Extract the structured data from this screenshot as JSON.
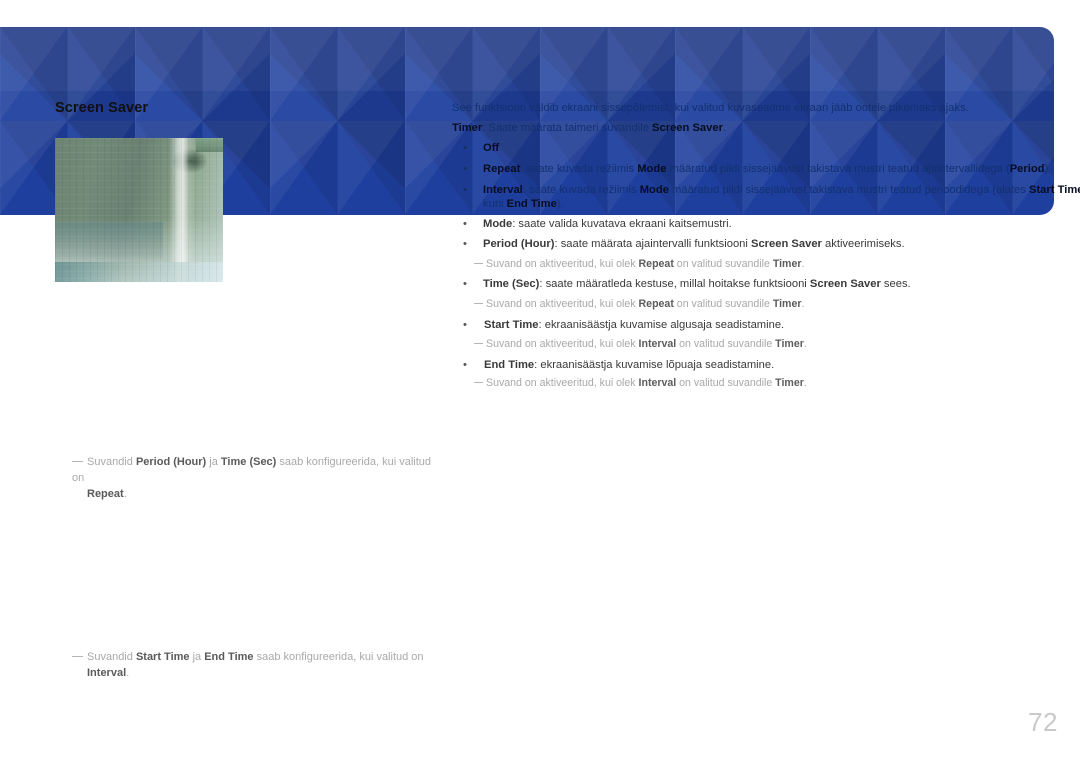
{
  "page": {
    "title": "Screen Saver",
    "number": "72",
    "band_color": "#1f3f9e",
    "thumbnail_name": "screen-saver-preview"
  },
  "intro": {
    "line1": "See funktsioon väldib ekraani sissepõlemist, kui valitud kuvaseadme ekraan jääb ootele pikemaks ajaks.",
    "timer_label": "Timer",
    "timer_rest": ": Saate määrata taimeri suvandile ",
    "timer_target": "Screen Saver",
    "timer_end": "."
  },
  "bullets": [
    {
      "label": "Off",
      "rest": "",
      "on_blue": true
    },
    {
      "label": "Repeat",
      "rest": ": saate kuvada režiimis ",
      "mid_bold": "Mode",
      "rest2": " määratud pildi sissejäävust takistava mustri teatud ajaintervallidega (",
      "end_bold": "Period",
      "rest3": ").",
      "on_blue": true
    },
    {
      "label": "Interval",
      "rest": ": saate kuvada režiimis ",
      "mid_bold": "Mode",
      "rest2": " määratud pildi sissejäävust takistava mustri teatud perioodidega (alates ",
      "end_bold": "Start Time",
      "rest3": "",
      "wrap_prefix": "kuni ",
      "wrap_bold": "End Time",
      "wrap_suffix": ").",
      "on_blue": true
    },
    {
      "label": "Mode",
      "rest": ": saate valida kuvatava ekraani kaitsemustri.",
      "on_blue": false
    },
    {
      "label": "Period (Hour)",
      "rest": ": saate määrata ajaintervalli funktsiooni ",
      "mid_bold": "Screen Saver",
      "rest2": " aktiveerimiseks.",
      "on_blue": false
    },
    {
      "label": "Time (Sec)",
      "rest": ": saate määratleda kestuse, millal hoitakse funktsiooni ",
      "mid_bold": "Screen Saver",
      "rest2": " sees.",
      "on_blue": false
    },
    {
      "label": "Start Time",
      "rest": ": ekraanisäästja kuvamise algusaja seadistamine.",
      "on_blue": false
    },
    {
      "label": "End Time",
      "rest": ": ekraanisäästja kuvamise lõpuaja seadistamine.",
      "on_blue": false
    }
  ],
  "subnotes": [
    {
      "pre": "Suvand on aktiveeritud, kui olek ",
      "bold1": "Repeat",
      "mid": " on valitud suvandile ",
      "bold2": "Timer",
      "post": "."
    },
    {
      "pre": "Suvand on aktiveeritud, kui olek ",
      "bold1": "Repeat",
      "mid": " on valitud suvandile ",
      "bold2": "Timer",
      "post": "."
    },
    {
      "pre": "Suvand on aktiveeritud, kui olek ",
      "bold1": "Interval",
      "mid": " on valitud suvandile ",
      "bold2": "Timer",
      "post": "."
    },
    {
      "pre": "Suvand on aktiveeritud, kui olek ",
      "bold1": "Interval",
      "mid": " on valitud suvandile ",
      "bold2": "Timer",
      "post": "."
    }
  ],
  "footnotes": [
    {
      "pre": "Suvandid ",
      "bold1": "Period (Hour)",
      "mid": " ja ",
      "bold2": "Time (Sec)",
      "post": " saab konfigureerida, kui valitud on",
      "cont_bold": "Repeat",
      "cont_post": "."
    },
    {
      "pre": "Suvandid ",
      "bold1": "Start Time",
      "mid": " ja ",
      "bold2": "End Time",
      "post": " saab konfigureerida, kui valitud on",
      "cont_bold": "Interval",
      "cont_post": "."
    }
  ]
}
